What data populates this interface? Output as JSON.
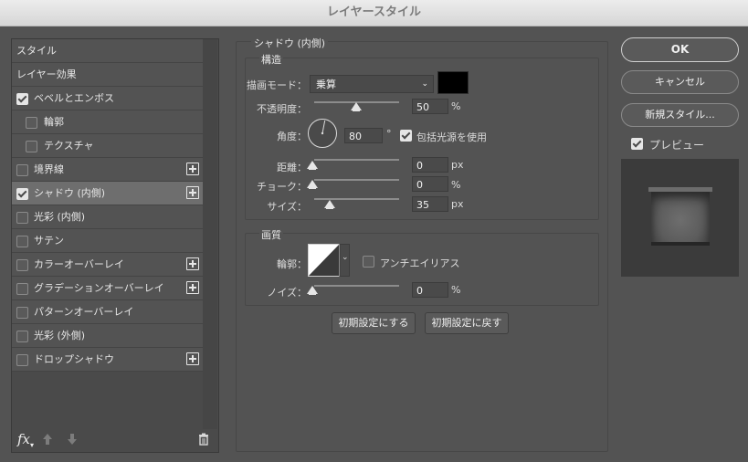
{
  "window": {
    "title": "レイヤースタイル"
  },
  "sidebar": {
    "items": [
      {
        "label": "スタイル",
        "checkbox": false,
        "checked": false,
        "plus": false,
        "selected": false
      },
      {
        "label": "レイヤー効果",
        "checkbox": false,
        "checked": false,
        "plus": false,
        "selected": false
      },
      {
        "label": "ベベルとエンボス",
        "checkbox": true,
        "checked": true,
        "plus": false,
        "selected": false
      },
      {
        "label": "輪郭",
        "checkbox": true,
        "checked": false,
        "plus": false,
        "selected": false,
        "indent": true
      },
      {
        "label": "テクスチャ",
        "checkbox": true,
        "checked": false,
        "plus": false,
        "selected": false,
        "indent": true
      },
      {
        "label": "境界線",
        "checkbox": true,
        "checked": false,
        "plus": true,
        "selected": false
      },
      {
        "label": "シャドウ (内側)",
        "checkbox": true,
        "checked": true,
        "plus": true,
        "selected": true
      },
      {
        "label": "光彩 (内側)",
        "checkbox": true,
        "checked": false,
        "plus": false,
        "selected": false
      },
      {
        "label": "サテン",
        "checkbox": true,
        "checked": false,
        "plus": false,
        "selected": false
      },
      {
        "label": "カラーオーバーレイ",
        "checkbox": true,
        "checked": false,
        "plus": true,
        "selected": false
      },
      {
        "label": "グラデーションオーバーレイ",
        "checkbox": true,
        "checked": false,
        "plus": true,
        "selected": false
      },
      {
        "label": "パターンオーバーレイ",
        "checkbox": true,
        "checked": false,
        "plus": false,
        "selected": false
      },
      {
        "label": "光彩 (外側)",
        "checkbox": true,
        "checked": false,
        "plus": false,
        "selected": false
      },
      {
        "label": "ドロップシャドウ",
        "checkbox": true,
        "checked": false,
        "plus": true,
        "selected": false
      }
    ],
    "tools": {
      "fx": "fx",
      "up_icon": "arrow-up-icon",
      "down_icon": "arrow-down-icon",
      "trash_icon": "trash-icon"
    }
  },
  "panel": {
    "title": "シャドウ (内側)",
    "structure": {
      "title": "構造",
      "blend_mode_label": "描画モード：",
      "blend_mode_value": "乗算",
      "blend_color": "#000000",
      "opacity_label": "不透明度：",
      "opacity_value": "50",
      "opacity_unit": "%",
      "angle_label": "角度：",
      "angle_value": "80",
      "angle_unit": "°",
      "global_light_label": "包括光源を使用",
      "global_light_checked": true,
      "distance_label": "距離：",
      "distance_value": "0",
      "distance_unit": "px",
      "choke_label": "チョーク：",
      "choke_value": "0",
      "choke_unit": "%",
      "size_label": "サイズ：",
      "size_value": "35",
      "size_unit": "px"
    },
    "quality": {
      "title": "画質",
      "contour_label": "輪郭：",
      "antialias_label": "アンチエイリアス",
      "antialias_checked": false,
      "noise_label": "ノイズ：",
      "noise_value": "0",
      "noise_unit": "%"
    },
    "make_default_label": "初期設定にする",
    "reset_default_label": "初期設定に戻す"
  },
  "actions": {
    "ok_label": "OK",
    "cancel_label": "キャンセル",
    "new_style_label": "新規スタイル...",
    "preview_label": "プレビュー",
    "preview_checked": true
  }
}
